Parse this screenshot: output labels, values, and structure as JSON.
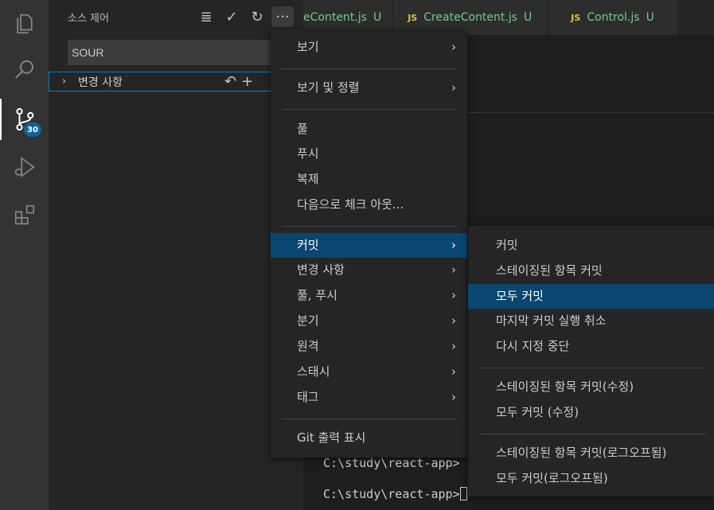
{
  "activity_bar": {
    "scm_badge": "30"
  },
  "sidebar": {
    "title": "소스 제어",
    "more_label": "···",
    "input_value": "SOUR",
    "changes_label": "변경 사항"
  },
  "tabs": [
    {
      "name": "eContent.js",
      "status": "U"
    },
    {
      "name": "CreateContent.js",
      "status": "U"
    },
    {
      "name": "Control.js",
      "status": "U"
    }
  ],
  "terminal": {
    "line1": "C:\\study\\react-app>",
    "line2": "C:\\study\\react-app>"
  },
  "menu": {
    "items": [
      {
        "label": "보기",
        "submenu": true
      },
      {
        "label": "보기 및 정렬",
        "submenu": true
      },
      {
        "label": "풀"
      },
      {
        "label": "푸시"
      },
      {
        "label": "복제"
      },
      {
        "label": "다음으로 체크 아웃..."
      },
      {
        "label": "커밋",
        "submenu": true,
        "highlighted": true
      },
      {
        "label": "변경 사항",
        "submenu": true
      },
      {
        "label": "풀, 푸시",
        "submenu": true
      },
      {
        "label": "분기",
        "submenu": true
      },
      {
        "label": "원격",
        "submenu": true
      },
      {
        "label": "스태시",
        "submenu": true
      },
      {
        "label": "태그",
        "submenu": true
      },
      {
        "label": "Git 출력 표시"
      }
    ]
  },
  "submenu": {
    "items": [
      {
        "label": "커밋"
      },
      {
        "label": "스테이징된 항목 커밋"
      },
      {
        "label": "모두 커밋",
        "highlighted": true
      },
      {
        "label": "마지막 커밋 실행 취소"
      },
      {
        "label": "다시 지정 중단"
      },
      {
        "label": "스테이징된 항목 커밋(수정)"
      },
      {
        "label": "모두 커밋 (수정)"
      },
      {
        "label": "스테이징된 항목 커밋(로그오프됨)"
      },
      {
        "label": "모두 커밋(로그오프됨)"
      }
    ]
  },
  "colors": {
    "accent": "#094771",
    "focus_border": "#007fd4",
    "badge": "#0e639c",
    "untracked": "#73c991",
    "js_icon": "#cbcb41"
  }
}
